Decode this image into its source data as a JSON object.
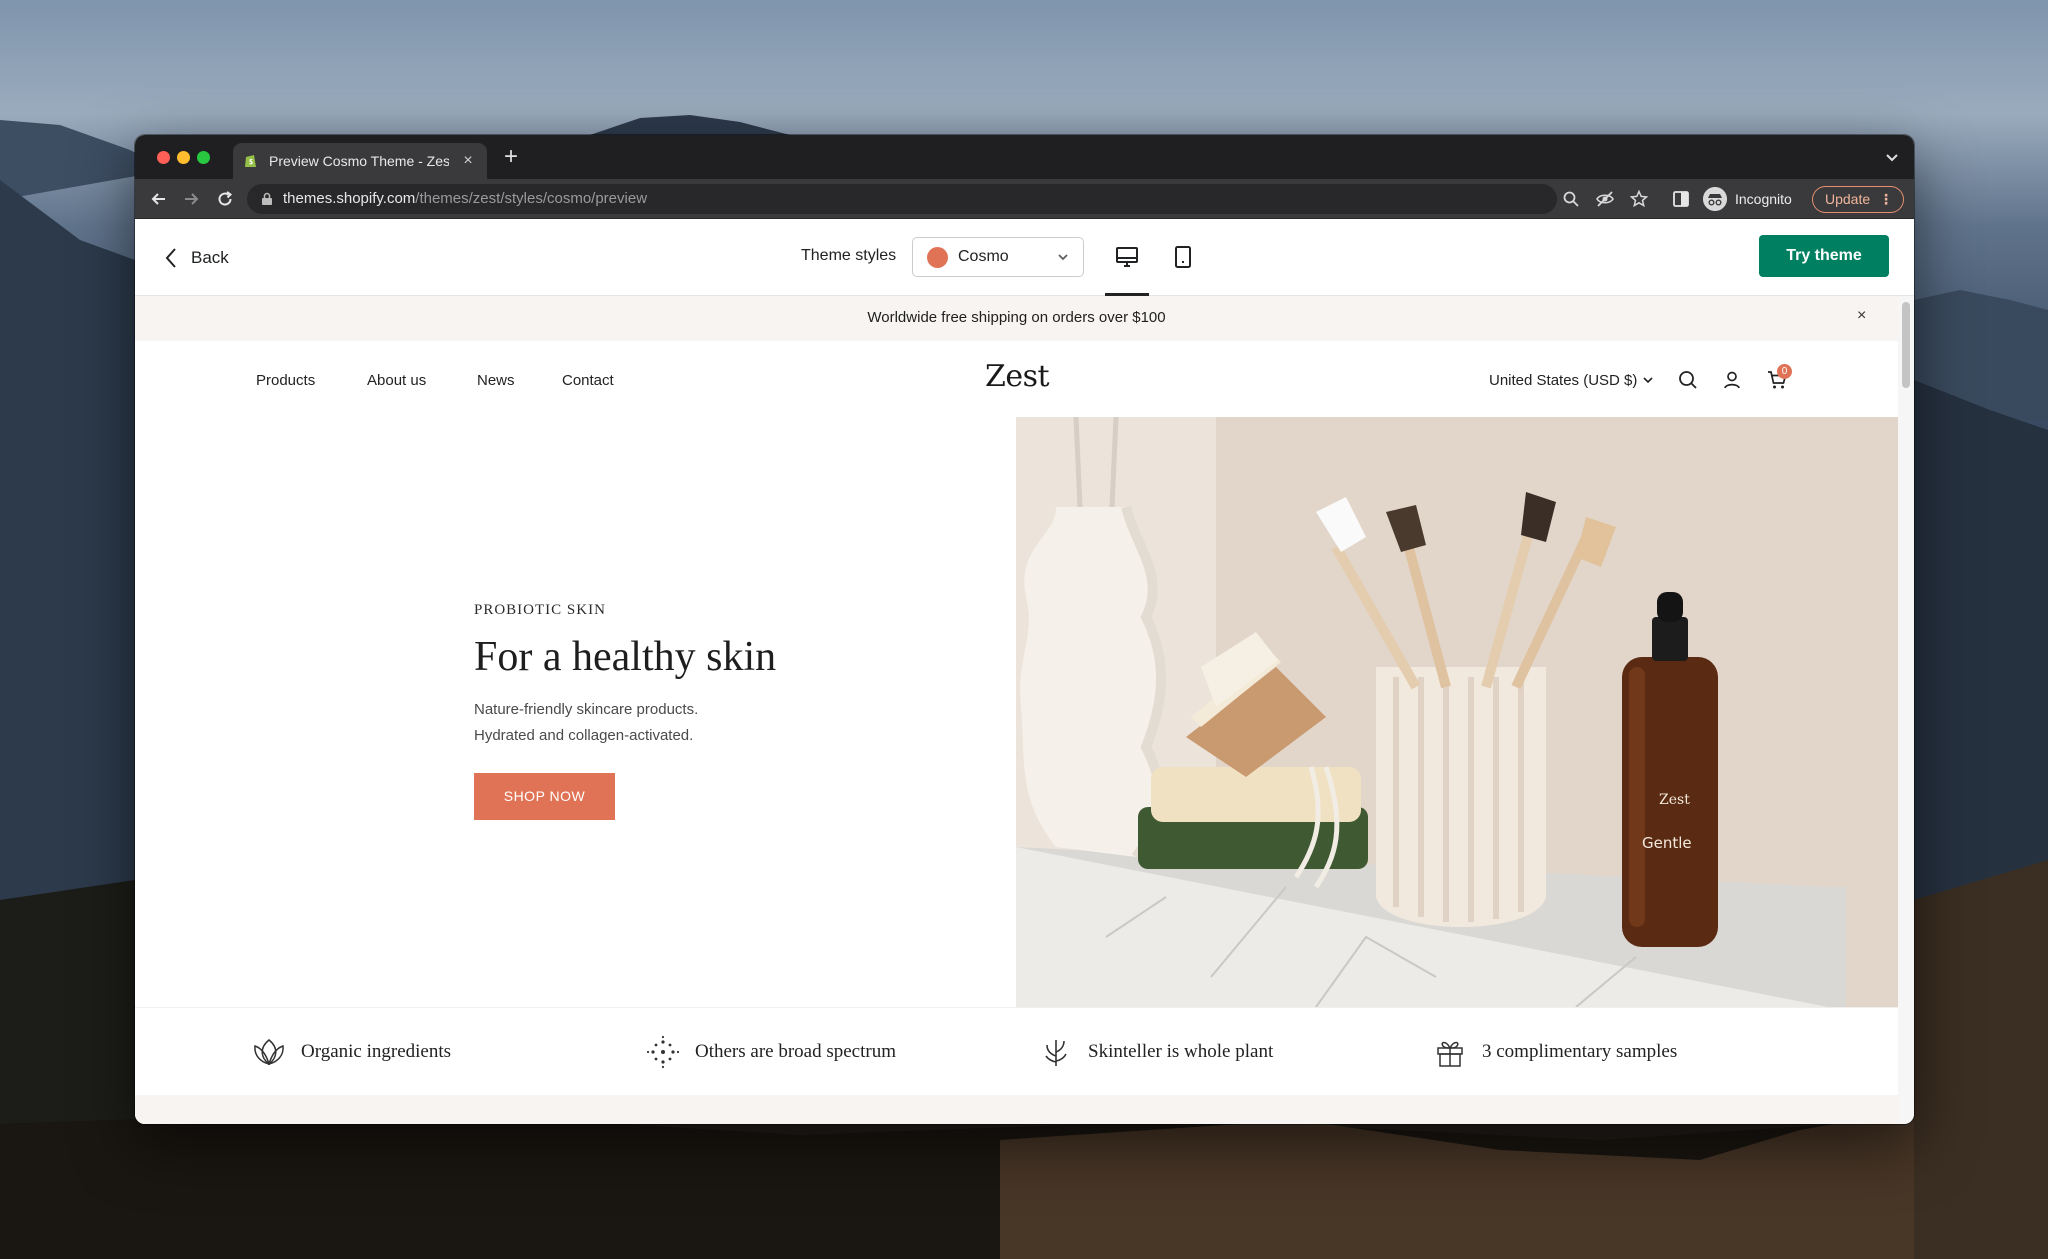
{
  "browser": {
    "tab_title": "Preview Cosmo Theme - Zest",
    "new_tab_symbol": "+",
    "tab_close_symbol": "×",
    "url_host": "themes.shopify.com",
    "url_path": "/themes/zest/styles/cosmo/preview",
    "profile_label": "Incognito",
    "update_label": "Update",
    "update_menu_symbol": "⋮"
  },
  "preview_bar": {
    "back_label": "Back",
    "theme_styles_label": "Theme styles",
    "selected_style": "Cosmo",
    "selected_style_color": "#e07356",
    "try_label": "Try theme",
    "try_color": "#008060",
    "active_device": "desktop"
  },
  "store": {
    "announcement": "Worldwide free shipping on orders over $100",
    "announcement_close": "×",
    "nav": [
      "Products",
      "About us",
      "News",
      "Contact"
    ],
    "logo": "Zest",
    "currency": "United States (USD $)",
    "cart_count": "0",
    "accent_color": "#e07356",
    "hero": {
      "eyebrow": "PROBIOTIC SKIN",
      "title": "For a healthy skin",
      "subtitle_line1": "Nature-friendly skincare products.",
      "subtitle_line2": "Hydrated and collagen-activated.",
      "cta": "SHOP NOW",
      "bottle_brand": "Zest",
      "bottle_label": "Gentle"
    },
    "features": [
      {
        "icon": "leaf-icon",
        "label": "Organic ingredients"
      },
      {
        "icon": "dots-burst-icon",
        "label": "Others are broad spectrum"
      },
      {
        "icon": "plant-sprout-icon",
        "label": "Skinteller is whole plant"
      },
      {
        "icon": "gift-icon",
        "label": "3 complimentary samples"
      }
    ]
  }
}
